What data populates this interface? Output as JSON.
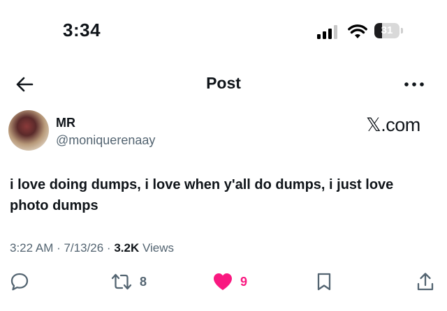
{
  "status_bar": {
    "time": "3:34",
    "battery_level": "31",
    "battery_fraction": 0.31
  },
  "nav": {
    "title": "Post"
  },
  "post": {
    "author_name": "MR",
    "author_handle": "@moniquerenaay",
    "brand": "𝕏.com",
    "text": "i love doing dumps, i love when y'all do dumps, i just love photo dumps",
    "timestamp": "3:22 AM · 7/13/26 · ",
    "views_count": "3.2K",
    "views_label": "Views"
  },
  "actions": {
    "reposts": "8",
    "likes": "9",
    "like_color": "#f91880",
    "icon_color": "#536471"
  }
}
